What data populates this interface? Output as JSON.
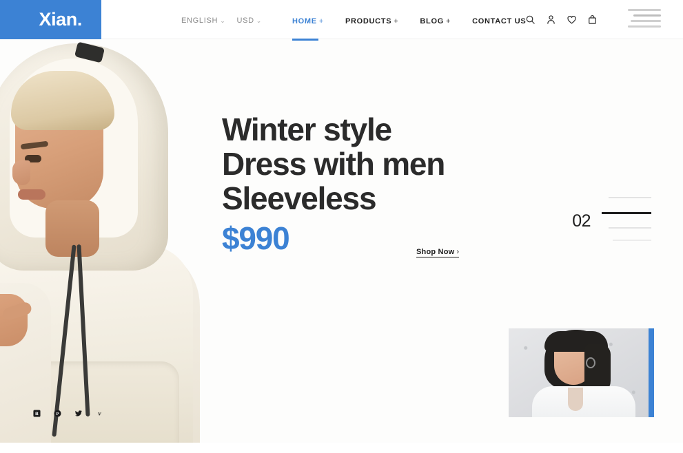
{
  "brand": {
    "name": "Xian.",
    "color": "#3c82d4"
  },
  "header": {
    "locale": [
      {
        "label": "ENGLISH",
        "caret": "⌄"
      },
      {
        "label": "USD",
        "caret": "⌄"
      }
    ],
    "nav": [
      {
        "label": "HOME",
        "plus": "+",
        "active": true
      },
      {
        "label": "PRODUCTS",
        "plus": "+",
        "active": false
      },
      {
        "label": "BLOG",
        "plus": "+",
        "active": false
      },
      {
        "label": "CONTACT US",
        "plus": "",
        "active": false
      }
    ],
    "icons": [
      "search-icon",
      "user-icon",
      "heart-icon",
      "bag-icon"
    ],
    "menu_icon": "hamburger-menu-icon"
  },
  "hero": {
    "heading_lines": [
      "Winter style",
      "Dress with men",
      "Sleeveless"
    ],
    "price": "$990",
    "cta": {
      "label": "Shop Now",
      "chevron": "›"
    },
    "slide_number": "02"
  },
  "social": [
    "behance-icon",
    "pinterest-icon",
    "twitter-icon",
    "vimeo-icon"
  ],
  "thumbnail": {
    "name": "next-slide-thumbnail",
    "accent": "#3c82d4"
  }
}
